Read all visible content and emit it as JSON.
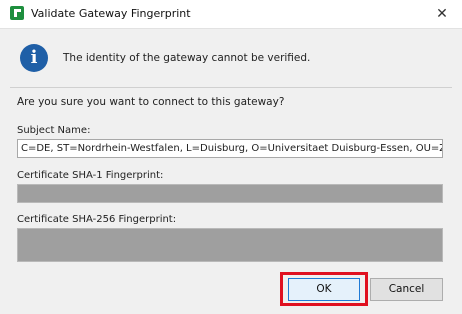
{
  "window": {
    "title": "Validate Gateway Fingerprint",
    "close_glyph": "✕",
    "app_icon": "gateway-app-icon"
  },
  "message": {
    "icon": "info-icon",
    "icon_glyph": "i",
    "text": "The identity of the gateway cannot be verified.",
    "question": "Are you sure you want to connect to this gateway?"
  },
  "fields": {
    "subject_label": "Subject Name:",
    "subject_value": "C=DE, ST=Nordrhein-Westfalen, L=Duisburg, O=Universitaet Duisburg-Essen, OU=ZIM",
    "sha1_label": "Certificate SHA-1 Fingerprint:",
    "sha1_value": "",
    "sha256_label": "Certificate SHA-256 Fingerprint:",
    "sha256_value": ""
  },
  "buttons": {
    "ok": "OK",
    "cancel": "Cancel"
  },
  "colors": {
    "highlight": "#e01020",
    "info_blue": "#1f5fa7",
    "redacted_gray": "#9f9f9f"
  }
}
